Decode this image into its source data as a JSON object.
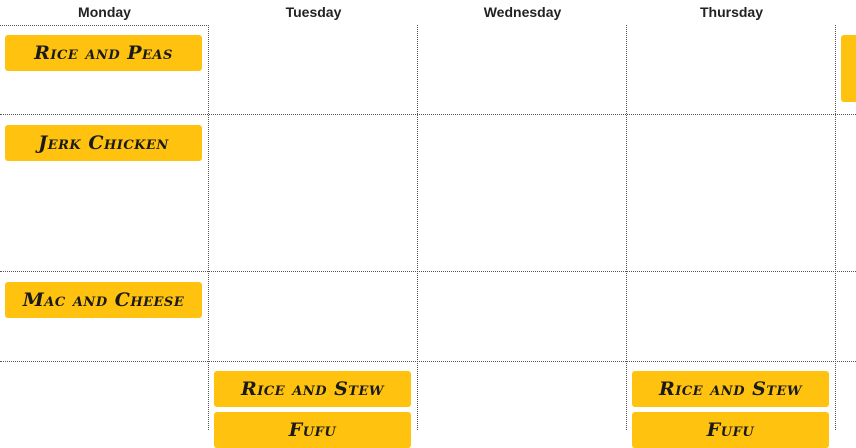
{
  "days": [
    "Monday",
    "Tuesday",
    "Wednesday",
    "Thursday"
  ],
  "meals": {
    "monday_row1": "Rice and Peas",
    "monday_row2": "Jerk Chicken",
    "monday_row3": "Mac and Cheese",
    "tuesday_row4_a": "Rice and Stew",
    "tuesday_row4_b": "Fufu",
    "thursday_row4_a": "Rice and Stew",
    "thursday_row4_b": "Fufu"
  },
  "colors": {
    "chip": "#ffc20e",
    "grid_line": "#555555"
  }
}
